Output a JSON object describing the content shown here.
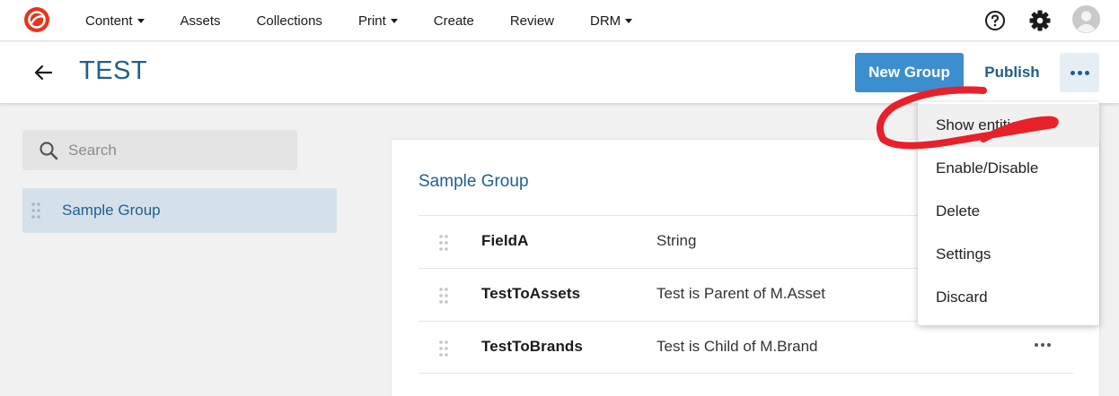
{
  "topnav": {
    "items": [
      {
        "label": "Content",
        "dropdown": true
      },
      {
        "label": "Assets",
        "dropdown": false
      },
      {
        "label": "Collections",
        "dropdown": false
      },
      {
        "label": "Print",
        "dropdown": true
      },
      {
        "label": "Create",
        "dropdown": false
      },
      {
        "label": "Review",
        "dropdown": false
      },
      {
        "label": "DRM",
        "dropdown": true
      }
    ],
    "icons": [
      "logo-icon",
      "help-icon",
      "gear-icon",
      "avatar-icon"
    ]
  },
  "header": {
    "title": "TEST",
    "new_group_label": "New Group",
    "publish_label": "Publish"
  },
  "sidebar": {
    "search_placeholder": "Search",
    "groups": [
      {
        "label": "Sample Group",
        "selected": true
      }
    ]
  },
  "main": {
    "group_title": "Sample Group",
    "fields": [
      {
        "name": "FieldA",
        "type": "String"
      },
      {
        "name": "TestToAssets",
        "type": "Test is Parent of M.Asset"
      },
      {
        "name": "TestToBrands",
        "type": "Test is Child of M.Brand"
      }
    ]
  },
  "menu": {
    "items": [
      {
        "label": "Show entities",
        "highlighted": true
      },
      {
        "label": "Enable/Disable",
        "highlighted": false
      },
      {
        "label": "Delete",
        "highlighted": false
      },
      {
        "label": "Settings",
        "highlighted": false
      },
      {
        "label": "Discard",
        "highlighted": false
      }
    ]
  },
  "colors": {
    "accent_blue": "#3c8fcf",
    "title_blue": "#1f5f8b",
    "logo_red": "#e8331c",
    "annotation_red": "#e8202a"
  }
}
